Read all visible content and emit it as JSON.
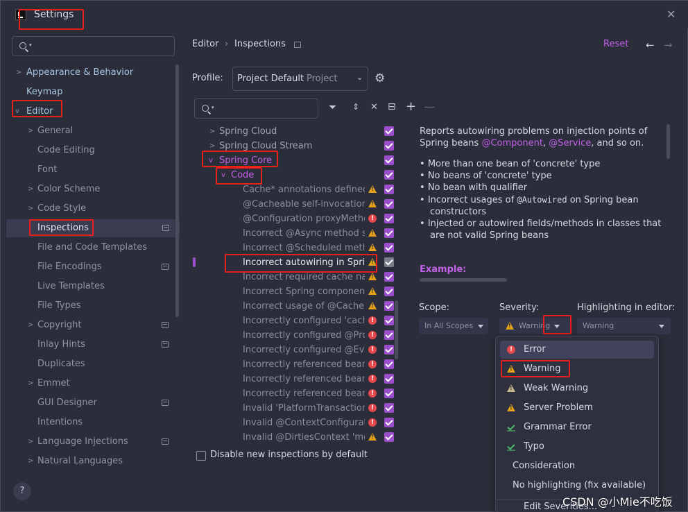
{
  "window": {
    "title": "Settings"
  },
  "search": {
    "placeholder": ""
  },
  "sidebar": {
    "items": [
      {
        "label": "Appearance & Behavior"
      },
      {
        "label": "Keymap"
      },
      {
        "label": "Editor"
      },
      {
        "label": "General"
      },
      {
        "label": "Code Editing"
      },
      {
        "label": "Font"
      },
      {
        "label": "Color Scheme"
      },
      {
        "label": "Code Style"
      },
      {
        "label": "Inspections"
      },
      {
        "label": "File and Code Templates"
      },
      {
        "label": "File Encodings"
      },
      {
        "label": "Live Templates"
      },
      {
        "label": "File Types"
      },
      {
        "label": "Copyright"
      },
      {
        "label": "Inlay Hints"
      },
      {
        "label": "Duplicates"
      },
      {
        "label": "Emmet"
      },
      {
        "label": "GUI Designer"
      },
      {
        "label": "Intentions"
      },
      {
        "label": "Language Injections"
      },
      {
        "label": "Natural Languages"
      }
    ],
    "help": "?"
  },
  "header": {
    "breadcrumb": [
      "Editor",
      "Inspections"
    ],
    "reset": "Reset"
  },
  "profile": {
    "label": "Profile:",
    "name": "Project Default",
    "scope": "Project"
  },
  "tree": {
    "rows": [
      {
        "label": "Spring Cloud"
      },
      {
        "label": "Spring Cloud Stream"
      },
      {
        "label": "Spring Core"
      },
      {
        "label": "Code"
      },
      {
        "label": "Cache* annotations defined"
      },
      {
        "label": "@Cacheable self-invocation"
      },
      {
        "label": "@Configuration proxyMetho"
      },
      {
        "label": "Incorrect @Async method si"
      },
      {
        "label": "Incorrect @Scheduled metho"
      },
      {
        "label": "Incorrect autowiring in Sprin"
      },
      {
        "label": "Incorrect required cache nar"
      },
      {
        "label": "Incorrect Spring component"
      },
      {
        "label": "Incorrect usage of @CacheP"
      },
      {
        "label": "Incorrectly configured 'cachi"
      },
      {
        "label": "Incorrectly configured @Prot"
      },
      {
        "label": "Incorrectly configured  @Eve"
      },
      {
        "label": "Incorrectly referenced bean"
      },
      {
        "label": "Incorrectly referenced bean"
      },
      {
        "label": "Incorrectly referenced bean"
      },
      {
        "label": "Invalid 'PlatformTransactionM"
      },
      {
        "label": "Invalid @ContextConfiguratic"
      },
      {
        "label": "Invalid @DirtiesContext 'moc"
      }
    ],
    "disable_new": "Disable new inspections by default"
  },
  "description": {
    "intro_1": "Reports autowiring problems on injection points of",
    "intro_2a": "Spring beans ",
    "intro_component": "@Component",
    "intro_comma": ", ",
    "intro_service": "@Service",
    "intro_2b": ", and so on.",
    "bullets": [
      "More than one bean of 'concrete' type",
      "No beans of 'concrete' type",
      "No bean with qualifier"
    ],
    "bullet4a": "Incorrect usages of ",
    "bullet4code": "@Autowired",
    "bullet4b": " on Spring bean",
    "bullet4c": "constructors",
    "bullet5a": "Injected or autowired fields/methods in classes that",
    "bullet5b": "are not valid Spring beans",
    "example": "Example:"
  },
  "options": {
    "scope_label": "Scope:",
    "scope_value": "In All Scopes",
    "severity_label": "Severity:",
    "severity_value": "Warning",
    "highlight_label": "Highlighting in editor:",
    "highlight_value": "Warning"
  },
  "severity_menu": {
    "items": [
      {
        "label": "Error"
      },
      {
        "label": "Warning"
      },
      {
        "label": "Weak Warning"
      },
      {
        "label": "Server Problem"
      },
      {
        "label": "Grammar Error"
      },
      {
        "label": "Typo"
      },
      {
        "label": "Consideration"
      },
      {
        "label": "No highlighting (fix available)"
      },
      {
        "label": "Edit Severities..."
      }
    ]
  },
  "watermark": "CSDN @小Mie不吃饭",
  "colors": {
    "accent": "#c262e6",
    "checkbox": "#9a4ec9",
    "error": "#e5484d",
    "warning": "#e3a21a",
    "highlight_box": "#e8201a"
  }
}
